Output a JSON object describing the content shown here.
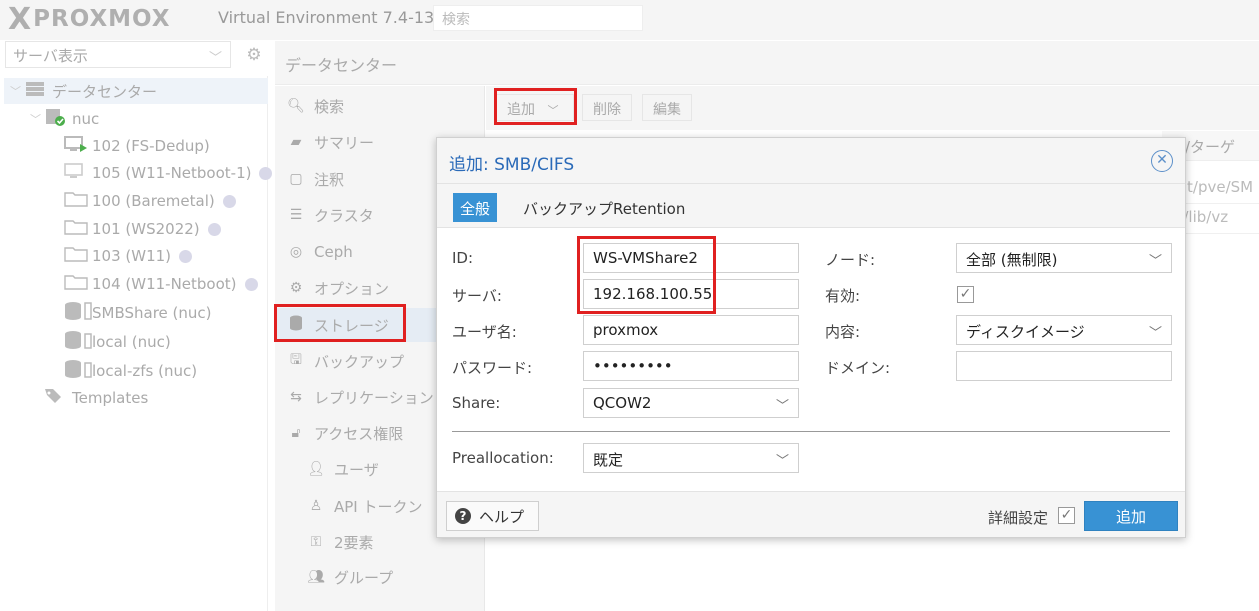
{
  "app": {
    "logo_x": "X",
    "logo_word": "PROXMOX",
    "version": "Virtual Environment 7.4-13",
    "search_placeholder": "検索"
  },
  "tree": {
    "view_label": "サーバ表示",
    "items": [
      {
        "label": "データセンター",
        "icon": "datacenter-icon"
      },
      {
        "label": "nuc",
        "icon": "node-icon"
      },
      {
        "label": "102 (FS-Dedup)",
        "icon": "vm-running-icon"
      },
      {
        "label": "105 (W11-Netboot-1)",
        "icon": "vm-icon"
      },
      {
        "label": "100 (Baremetal)",
        "icon": "template-icon"
      },
      {
        "label": "101 (WS2022)",
        "icon": "template-icon"
      },
      {
        "label": "103 (W11)",
        "icon": "template-icon"
      },
      {
        "label": "104 (W11-Netboot)",
        "icon": "template-icon"
      },
      {
        "label": "SMBShare (nuc)",
        "icon": "storage-icon"
      },
      {
        "label": "local (nuc)",
        "icon": "storage-icon"
      },
      {
        "label": "local-zfs (nuc)",
        "icon": "storage-icon"
      },
      {
        "label": "Templates",
        "icon": "tags-icon"
      }
    ]
  },
  "panel": {
    "title": "データセンター"
  },
  "nav": {
    "items": [
      {
        "label": "検索",
        "icon": "search-icon"
      },
      {
        "label": "サマリー",
        "icon": "book-icon"
      },
      {
        "label": "注釈",
        "icon": "note-icon"
      },
      {
        "label": "クラスタ",
        "icon": "server-icon"
      },
      {
        "label": "Ceph",
        "icon": "ceph-icon"
      },
      {
        "label": "オプション",
        "icon": "gear-icon"
      },
      {
        "label": "ストレージ",
        "icon": "database-icon"
      },
      {
        "label": "バックアップ",
        "icon": "floppy-icon"
      },
      {
        "label": "レプリケーション",
        "icon": "retweet-icon"
      },
      {
        "label": "アクセス権限",
        "icon": "unlock-icon"
      },
      {
        "label": "ユーザ",
        "icon": "user-icon"
      },
      {
        "label": "API トークン",
        "icon": "user-outline-icon"
      },
      {
        "label": "2要素",
        "icon": "key-icon"
      },
      {
        "label": "グループ",
        "icon": "users-icon"
      }
    ]
  },
  "toolbar": {
    "add": "追加",
    "remove": "削除",
    "edit": "編集"
  },
  "grid": {
    "header": "ス/ターゲ",
    "rows": [
      "nnt/pve/SM",
      "ar/lib/vz"
    ]
  },
  "dialog": {
    "title": "追加: SMB/CIFS",
    "tabs": [
      "全般",
      "バックアップRetention"
    ],
    "fields": {
      "id_label": "ID:",
      "id_value": "WS-VMShare2",
      "server_label": "サーバ:",
      "server_value": "192.168.100.55",
      "username_label": "ユーザ名:",
      "username_value": "proxmox",
      "password_label": "パスワード:",
      "password_value": "•••••••••",
      "share_label": "Share:",
      "share_value": "QCOW2",
      "node_label": "ノード:",
      "node_value": "全部 (無制限)",
      "enabled_label": "有効:",
      "content_label": "内容:",
      "content_value": "ディスクイメージ",
      "domain_label": "ドメイン:",
      "domain_value": "",
      "prealloc_label": "Preallocation:",
      "prealloc_value": "既定"
    },
    "footer": {
      "help": "ヘルプ",
      "advanced": "詳細設定",
      "submit": "追加"
    }
  },
  "colors": {
    "accent": "#3892d4",
    "title_blue": "#2a6ab8",
    "highlight": "#e02020"
  }
}
